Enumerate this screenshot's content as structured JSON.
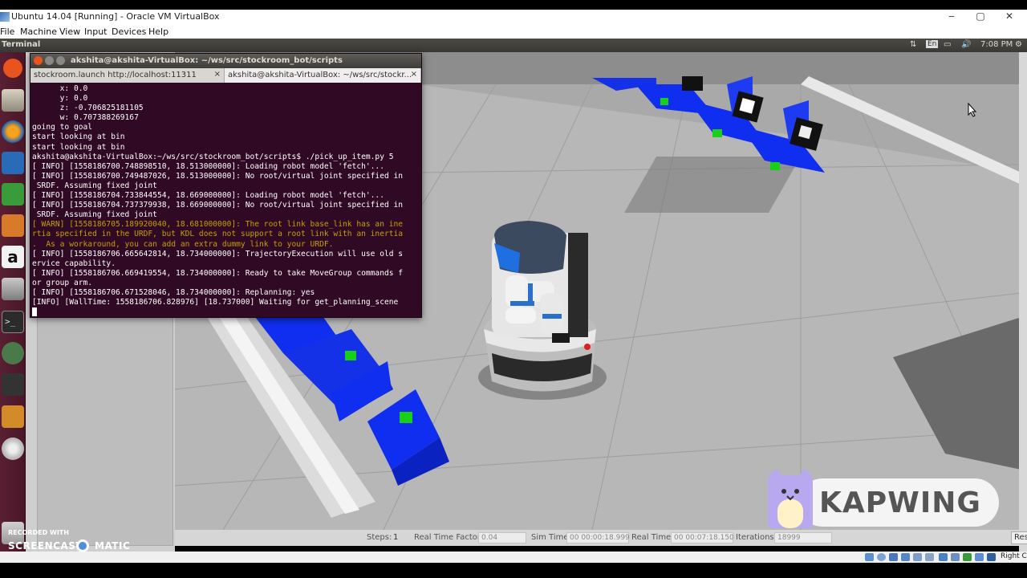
{
  "vbox": {
    "title": "Ubuntu 14.04 [Running] - Oracle VM VirtualBox",
    "menu": [
      "File",
      "Machine",
      "View",
      "Input",
      "Devices",
      "Help"
    ],
    "status_host_key": "Right Ctrl"
  },
  "ubuntu_panel": {
    "app_title": "Terminal",
    "indicators": [
      "⇅",
      "En",
      "▭",
      "🔊",
      "7:08 PM",
      "⚙"
    ]
  },
  "terminal": {
    "window_title": "akshita@akshita-VirtualBox: ~/ws/src/stockroom_bot/scripts",
    "tabs": [
      {
        "label": "stockroom.launch http://localhost:11311",
        "close": "×"
      },
      {
        "label": "akshita@akshita-VirtualBox: ~/ws/src/stockr...",
        "close": "×"
      }
    ],
    "lines": [
      {
        "text": "      x: 0.0",
        "kind": "normal"
      },
      {
        "text": "      y: 0.0",
        "kind": "normal"
      },
      {
        "text": "      z: -0.706825181105",
        "kind": "normal"
      },
      {
        "text": "      w: 0.707388269167",
        "kind": "normal"
      },
      {
        "text": "going to goal",
        "kind": "normal"
      },
      {
        "text": "start looking at bin",
        "kind": "normal"
      },
      {
        "text": "start looking at bin",
        "kind": "normal"
      },
      {
        "text": "akshita@akshita-VirtualBox:~/ws/src/stockroom_bot/scripts$ ./pick_up_item.py 5",
        "kind": "normal"
      },
      {
        "text": "[ INFO] [1558186700.748898510, 18.513000000]: Loading robot model 'fetch'...",
        "kind": "normal"
      },
      {
        "text": "[ INFO] [1558186700.749487026, 18.513000000]: No root/virtual joint specified in",
        "kind": "normal"
      },
      {
        "text": " SRDF. Assuming fixed joint",
        "kind": "normal"
      },
      {
        "text": "[ INFO] [1558186704.733844554, 18.669000000]: Loading robot model 'fetch'...",
        "kind": "normal"
      },
      {
        "text": "[ INFO] [1558186704.737379938, 18.669000000]: No root/virtual joint specified in",
        "kind": "normal"
      },
      {
        "text": " SRDF. Assuming fixed joint",
        "kind": "normal"
      },
      {
        "text": "[ WARN] [1558186705.189920040, 18.681000000]: The root link base_link has an ine",
        "kind": "warn"
      },
      {
        "text": "rtia specified in the URDF, but KDL does not support a root link with an inertia",
        "kind": "warn"
      },
      {
        "text": ".  As a workaround, you can add an extra dummy link to your URDF.",
        "kind": "warn"
      },
      {
        "text": "[ INFO] [1558186706.665642814, 18.734000000]: TrajectoryExecution will use old s",
        "kind": "normal"
      },
      {
        "text": "ervice capability.",
        "kind": "normal"
      },
      {
        "text": "[ INFO] [1558186706.669419554, 18.734000000]: Ready to take MoveGroup commands f",
        "kind": "normal"
      },
      {
        "text": "or group arm.",
        "kind": "normal"
      },
      {
        "text": "[ INFO] [1558186706.671528046, 18.734000000]: Replanning: yes",
        "kind": "normal"
      },
      {
        "text": "[INFO] [WallTime: 1558186706.828976] [18.737000] Waiting for get_planning_scene",
        "kind": "normal"
      }
    ]
  },
  "gazebo_toolbar": {
    "steps_label": "Steps:",
    "steps_value": "1",
    "rtf_label": "Real Time Factor:",
    "rtf_value": "0.04",
    "sim_label": "Sim Time:",
    "sim_value": "00 00:00:18.999",
    "real_label": "Real Time:",
    "real_value": "00 00:07:18.150",
    "iter_label": "Iterations:",
    "iter_value": "18999",
    "reset_label": "Reset"
  },
  "watermarks": {
    "recorded_with": "RECORDED WITH",
    "screencast_a": "SCREENCAST",
    "screencast_b": "MATIC",
    "kapwing": "KAPWING"
  },
  "colors": {
    "terminal_bg": "#300a24",
    "launcher_bg": "#4a1628",
    "bin_blue": "#0a2ee6",
    "item_green": "#18d018"
  }
}
